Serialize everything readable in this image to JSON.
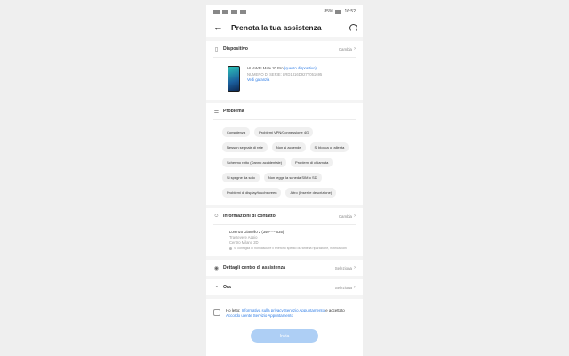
{
  "status_bar": {
    "battery": "85%",
    "time": "16:52"
  },
  "header": {
    "title": "Prenota la tua assistenza"
  },
  "device": {
    "title": "Dispositivo",
    "action": "Cambia",
    "model": "HUAWEI Mate 20 Pro",
    "model_link": "(questo dispositivo)",
    "serial": "NUMERO DI SERIE: LRD1316D927T051695",
    "warranty": "Vedi garanzia"
  },
  "problem": {
    "title": "Problema",
    "chips": [
      "Consulenza",
      "Problemi VPN/Connessione 4G",
      "Nessun segnale di rete",
      "Non si accende",
      "Si blocca o rallenta",
      "Schermo rotto (Danno accidentale)",
      "Problemi di chiamata",
      "Si spegne da solo",
      "Non legge la scheda SIM o SD",
      "Problemi di display/touchscreen",
      "Altro (Inserire descrizione)"
    ]
  },
  "contact": {
    "title": "Informazioni di contatto",
    "action": "Cambia",
    "name": "Lorenzo Gianello 2 (340*****035)",
    "line2": "Trastevere Appio",
    "line3": "Centro Milano 2D",
    "note": "Si consiglia di non lasciare il telefono spento durante la riparazione, notificazioni"
  },
  "center": {
    "title": "Dettagli centro di assistenza",
    "action": "Seleziona"
  },
  "date": {
    "title": "Ora",
    "action": "Seleziona"
  },
  "agreement": {
    "prefix": "Ho letto: ",
    "link1": "Informativa sulla privacy Servizio Appuntamento",
    "middle": " e accettato ",
    "link2": "Accordo utente Servizio Appuntamento"
  },
  "submit_label": "Invia"
}
